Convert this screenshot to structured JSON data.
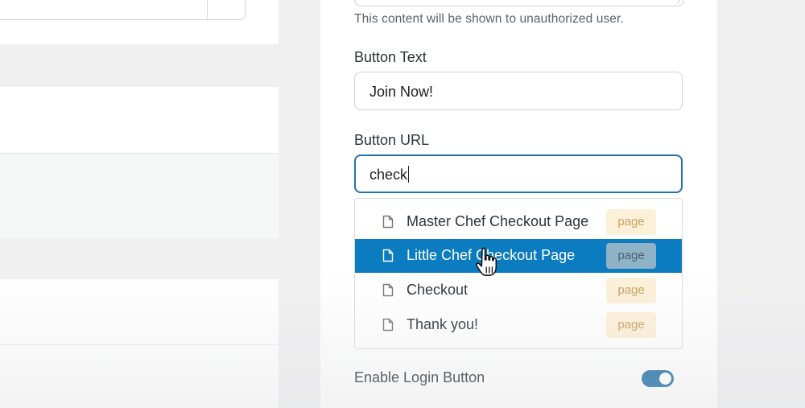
{
  "panel": {
    "help_text": "This content will be shown to unauthorized user.",
    "button_text": {
      "label": "Button Text",
      "value": "Join Now!"
    },
    "button_url": {
      "label": "Button URL",
      "value": "check"
    },
    "suggestions": [
      {
        "title": "Master Chef Checkout Page",
        "type": "page",
        "selected": false
      },
      {
        "title": "Little Chef Checkout Page",
        "type": "page",
        "selected": true
      },
      {
        "title": "Checkout",
        "type": "page",
        "selected": false
      },
      {
        "title": "Thank you!",
        "type": "page",
        "selected": false
      }
    ],
    "login_button": {
      "label": "Enable Login Button",
      "enabled": true
    }
  },
  "colors": {
    "accent": "#2271b1",
    "selected_row": "#0c7cc0",
    "badge_bg": "#fcf0d8",
    "toggle_on": "#1e6fa8"
  },
  "icons": {
    "suggestion_icon": "page-document-icon",
    "cursor": "hand-pointer-cursor"
  }
}
